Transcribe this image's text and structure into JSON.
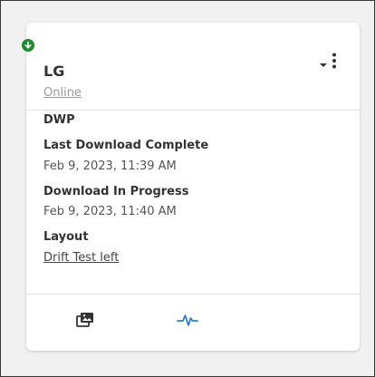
{
  "device": {
    "name": "LG",
    "status": "Online",
    "status_color": "#1e8a2e"
  },
  "details": {
    "dwp_label": "DWP",
    "last_download_label": "Last Download Complete",
    "last_download_value": "Feb 9, 2023, 11:39 AM",
    "in_progress_label": "Download In Progress",
    "in_progress_value": "Feb 9, 2023, 11:40 AM",
    "layout_label": "Layout",
    "layout_value": "Drift Test left"
  },
  "icons": {
    "status": "download-arrow-icon",
    "menu_caret": "caret-down-icon",
    "menu_kebab": "kebab-menu-icon",
    "gallery": "image-gallery-icon",
    "activity": "activity-pulse-icon"
  },
  "colors": {
    "accent": "#2b7fd4",
    "status_online": "#1e8a2e"
  }
}
